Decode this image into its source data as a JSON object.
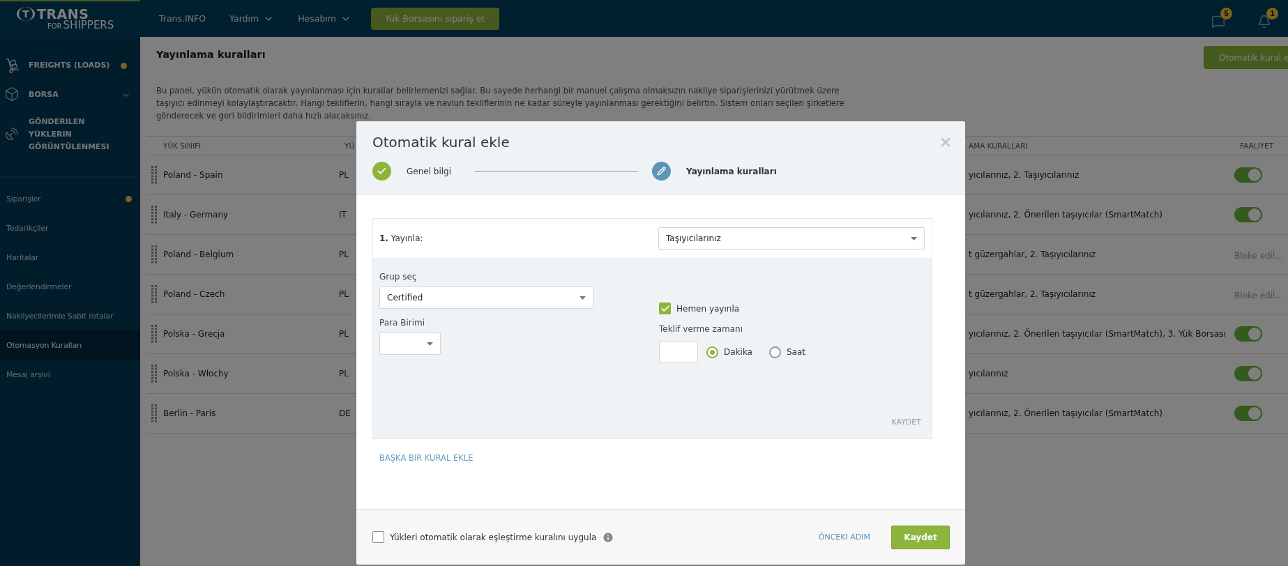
{
  "logo": {
    "mark": "T",
    "name": "TRANS",
    "sub_small": "FOR",
    "sub": "SHIPPERS"
  },
  "topbar": {
    "nav": [
      {
        "label": "Trans.INFO",
        "dropdown": false
      },
      {
        "label": "Yardım",
        "dropdown": true
      },
      {
        "label": "Hesabım",
        "dropdown": true
      }
    ],
    "order_button": "Yük Borsasını sipariş et",
    "notifications": [
      {
        "kind": "chat",
        "count": "5"
      },
      {
        "kind": "bell",
        "count": "1"
      }
    ]
  },
  "sidebar": {
    "main_items": [
      {
        "label": "FREIGHTS (LOADS)",
        "dot": true,
        "submenu": false
      },
      {
        "label": "BORSA",
        "dot": false,
        "submenu": true
      },
      {
        "label": "GÖNDERILEN YÜKLERIN GÖRÜNTÜLENMESI",
        "dot": false,
        "submenu": false
      }
    ],
    "items": [
      {
        "label": "Siparişler",
        "dot": true,
        "selected": false
      },
      {
        "label": "Tedarikçiler",
        "dot": false,
        "selected": false
      },
      {
        "label": "Haritalar",
        "dot": false,
        "selected": false
      },
      {
        "label": "Değerlendirmeler",
        "dot": false,
        "selected": false
      },
      {
        "label": "Nakliyecilerimle Sabit rotalar",
        "dot": false,
        "selected": false
      },
      {
        "label": "Otomasyon Kuralları",
        "dot": false,
        "selected": true
      },
      {
        "label": "Mesaj arşivi",
        "dot": false,
        "selected": false
      }
    ]
  },
  "page": {
    "title": "Yayınlama kuralları",
    "action_button": "Otomatik kural e",
    "description": "Bu panel, yükün otomatik olarak yayınlanması için kurallar belirlemenizi sağlar. Bu sayede herhangi bir manuel çalışma olmaksızın nakliye siparişlerinizi yürütmek üzere taşıyıcı edinmeyi kolaylaştıracaktır. Hangi tekliflerin, hangi sırayla ve navlun tekliflerinin ne kadar süreyle yayınlanması gerektiğini belirtin. Sistem onları seçilen şirketlere gönderecek ve geri bildirimleri daha hızlı alacaksınız.",
    "table": {
      "columns": [
        "YÜK SINIFI",
        "YÜ",
        "AMA KURALLARI",
        "FAALIYET"
      ],
      "rows": [
        {
          "route": "Poland - Spain",
          "column_2": "PL",
          "rules": "yıcılarınız, 2. Taşıyıcılarınız",
          "activity": {
            "kind": "toggle",
            "on": true
          }
        },
        {
          "route": "Italy - Germany",
          "column_2": "IT",
          "rules": "yıcılarınız, 2. Önerilen taşıyıcılar (SmartMatch)",
          "activity": {
            "kind": "toggle",
            "on": true
          }
        },
        {
          "route": "Poland - Belgium",
          "column_2": "PL",
          "rules": "t güzergahlar, 2. Taşıyıcılarınız",
          "activity": {
            "kind": "status",
            "text": "Bloke edil..."
          }
        },
        {
          "route": "Poland - Czech",
          "column_2": "PL",
          "rules": "t güzergahlar, 2. Taşıyıcılarınız",
          "activity": {
            "kind": "status",
            "text": "Bloke edil..."
          }
        },
        {
          "route": "Polska - Grecja",
          "column_2": "PL",
          "rules": "yıcılarınız, 2. Önerilen taşıyıcılar (SmartMatch), 3. Yük Borsası",
          "activity": {
            "kind": "toggle",
            "on": true
          }
        },
        {
          "route": "Polska - Włochy",
          "column_2": "PL",
          "rules": "yıcılarınız",
          "activity": {
            "kind": "toggle",
            "on": true
          }
        },
        {
          "route": "Berlin - Paris",
          "column_2": "DE",
          "rules": "yıcılarınız, 2. Önerilen taşıyıcılar (SmartMatch)",
          "activity": {
            "kind": "toggle",
            "on": true
          }
        }
      ]
    }
  },
  "modal": {
    "title": "Otomatik kural ekle",
    "steps": [
      {
        "label": "Genel bilgi",
        "completed": true
      },
      {
        "label": "Yayınlama kuralları",
        "completed": false
      }
    ],
    "rules": [
      {
        "heading": "**1.** Yayınla:",
        "target": "Taşıyıcılarınız",
        "group_label": "Grup seç",
        "group": "Certified",
        "currency_label": "Para Birimi",
        "publish_now": {
          "label": "Hemen yayınla",
          "checked": true
        },
        "bid_time_label": "Teklif verme zamanı",
        "units": [
          {
            "label": "Dakika",
            "selected": true
          },
          {
            "label": "Saat",
            "selected": false
          }
        ],
        "save": "KAYDET"
      }
    ],
    "add_rule": "BAŞKA BIR KURAL EKLE",
    "auto_match": {
      "label": "Yükleri otomatik olarak eşleştirme kuralını uygula",
      "checked": false
    },
    "back": "ÖNCEKI ADIM",
    "submit": "Kaydet"
  }
}
